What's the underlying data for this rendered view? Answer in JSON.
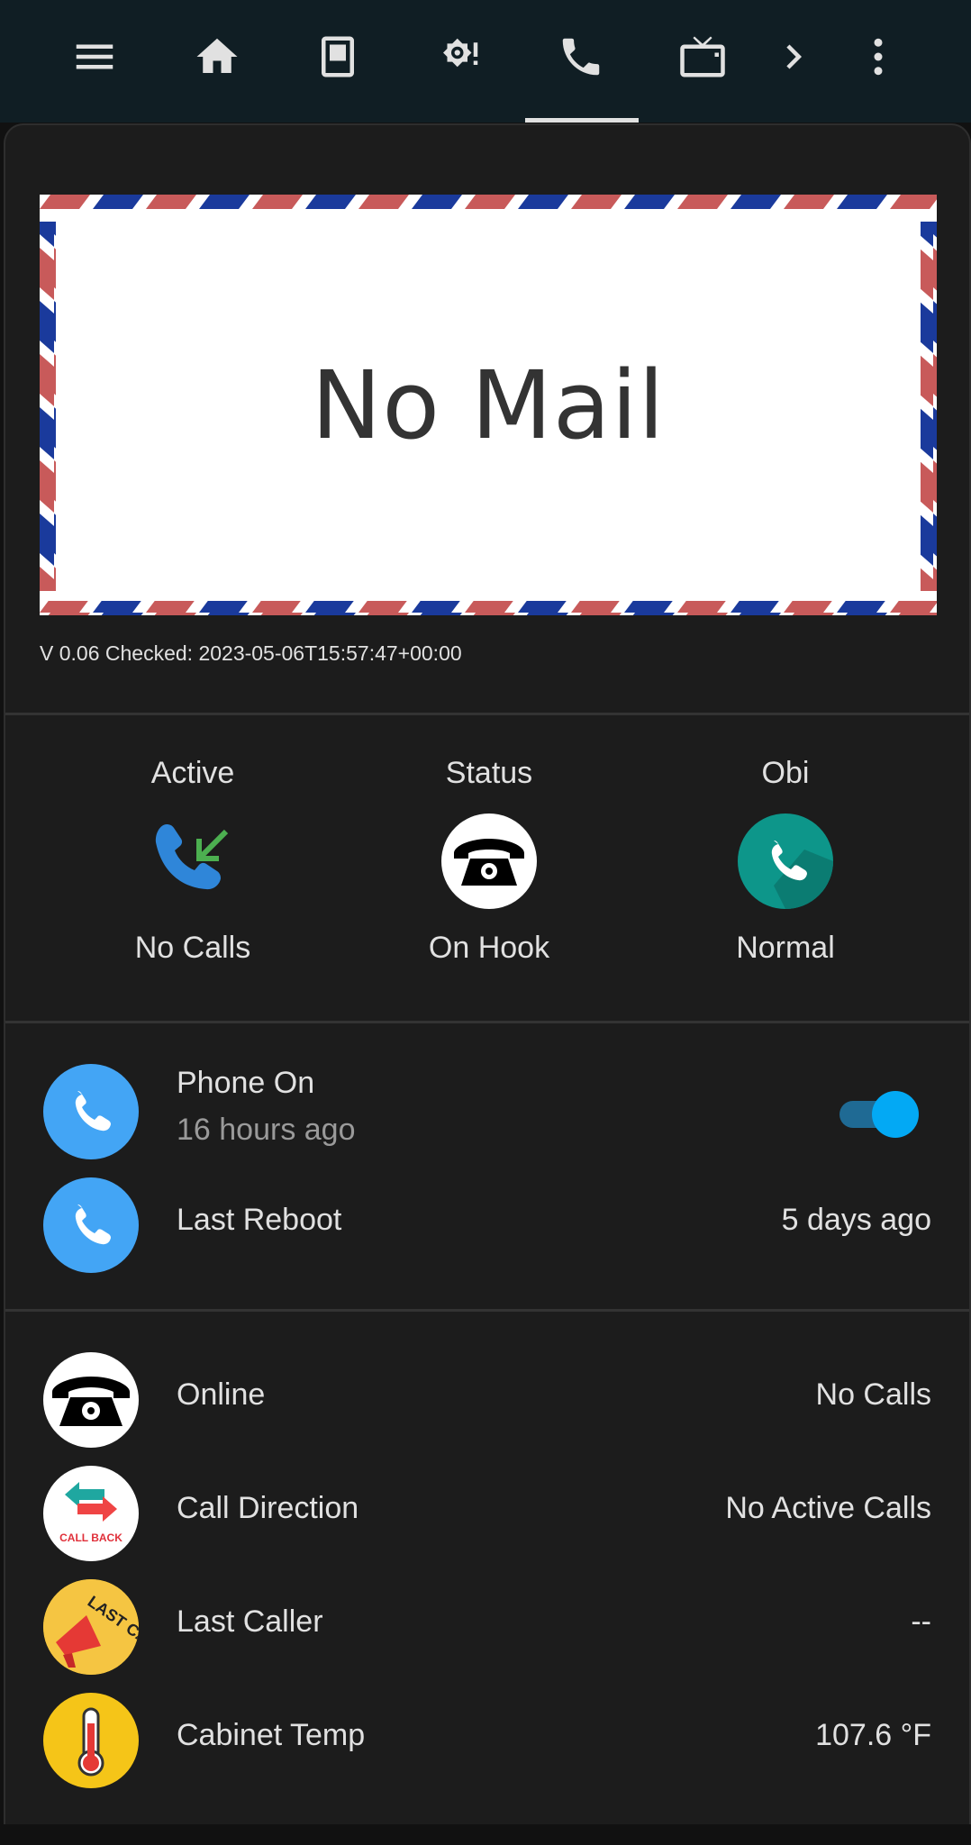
{
  "top_nav": {
    "tabs": [
      {
        "icon": "menu-icon"
      },
      {
        "icon": "home-icon"
      },
      {
        "icon": "tablet-icon"
      },
      {
        "icon": "brightness-alert-icon"
      },
      {
        "icon": "phone-icon",
        "active": true
      },
      {
        "icon": "tv-icon"
      },
      {
        "icon": "chevron-right-icon"
      },
      {
        "icon": "more-vertical-icon"
      }
    ]
  },
  "mail_card": {
    "image_text": "No Mail",
    "version_text": "V 0.06 Checked: 2023-05-06T15:57:47+00:00"
  },
  "glance": [
    {
      "title": "Active",
      "icon": "phone-incoming-icon",
      "state": "No Calls"
    },
    {
      "title": "Status",
      "icon": "rotary-phone-icon",
      "state": "On Hook"
    },
    {
      "title": "Obi",
      "icon": "phone-icon",
      "state": "Normal"
    }
  ],
  "phone_rows": [
    {
      "name": "Phone On",
      "secondary": "16 hours ago",
      "toggle_on": true,
      "icon": "phone-icon"
    },
    {
      "name": "Last Reboot",
      "value": "5 days ago",
      "icon": "phone-icon"
    }
  ],
  "info_rows": [
    {
      "name": "Online",
      "value": "No Calls",
      "icon": "rotary-phone-icon"
    },
    {
      "name": "Call Direction",
      "value": "No Active Calls",
      "icon": "call-back-icon",
      "icon_text": "CALL BACK"
    },
    {
      "name": "Last Caller",
      "value": "--",
      "icon": "megaphone-icon",
      "icon_text": "LAST CA"
    },
    {
      "name": "Cabinet Temp",
      "value": "107.6 °F",
      "icon": "thermometer-icon"
    }
  ],
  "colors": {
    "topbar_bg": "#101e24",
    "card_bg": "#1c1c1c",
    "accent_blue": "#43a5f5",
    "toggle_on": "#03a9f4",
    "obi_teal": "#0d968a"
  }
}
